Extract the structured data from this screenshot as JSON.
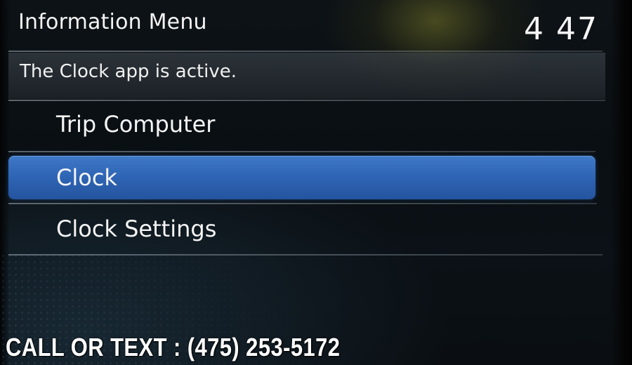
{
  "header": {
    "title": "Information Menu",
    "time": "4 47"
  },
  "status": {
    "message": "The Clock app is active."
  },
  "menu": {
    "items": [
      {
        "label": "Trip Computer",
        "selected": false
      },
      {
        "label": "Clock",
        "selected": true
      },
      {
        "label": "Clock Settings",
        "selected": false
      }
    ]
  },
  "overlay": {
    "contact": "CALL OR TEXT : (475) 253-5172"
  },
  "colors": {
    "selection": "#2f66b6",
    "background": "#0b1116",
    "text": "#f5f5f5"
  }
}
